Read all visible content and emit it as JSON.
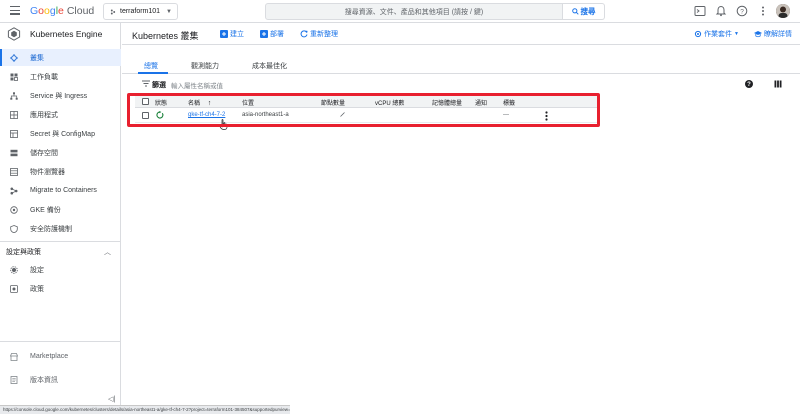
{
  "topbar": {
    "logo_google": [
      "G",
      "o",
      "o",
      "g",
      "l",
      "e"
    ],
    "logo_cloud": "Cloud",
    "project": "terraform101",
    "search_placeholder": "搜尋資源、文件、產品和其他項目 (請按 / 鍵)",
    "search_button": "搜尋"
  },
  "sidebar": {
    "product_title": "Kubernetes Engine",
    "items": [
      {
        "label": "叢集",
        "icon": "clusters-icon"
      },
      {
        "label": "工作負載",
        "icon": "workloads-icon"
      },
      {
        "label": "Service 與 Ingress",
        "icon": "services-icon"
      },
      {
        "label": "應用程式",
        "icon": "applications-icon"
      },
      {
        "label": "Secret 與 ConfigMap",
        "icon": "secrets-icon"
      },
      {
        "label": "儲存空間",
        "icon": "storage-icon"
      },
      {
        "label": "物件瀏覽器",
        "icon": "object-browser-icon"
      },
      {
        "label": "Migrate to Containers",
        "icon": "migrate-icon"
      },
      {
        "label": "GKE 備份",
        "icon": "backup-icon"
      },
      {
        "label": "安全防護機制",
        "icon": "security-icon"
      }
    ],
    "section_title": "設定與政策",
    "section_items": [
      {
        "label": "設定",
        "icon": "settings-icon"
      },
      {
        "label": "政策",
        "icon": "policy-icon"
      }
    ],
    "bottom_items": [
      {
        "label": "Marketplace",
        "icon": "marketplace-icon"
      },
      {
        "label": "版本資訊",
        "icon": "release-notes-icon"
      }
    ]
  },
  "main": {
    "title": "Kubernetes 叢集",
    "actions": {
      "create": "建立",
      "deploy": "部署",
      "refresh": "重新整理",
      "operations": "作業套件",
      "learn": "瞭解詳情"
    },
    "tabs": [
      "總覽",
      "觀測能力",
      "成本最佳化"
    ],
    "filter": {
      "label": "篩選",
      "placeholder": "輸入屬性名稱或值"
    },
    "table": {
      "headers": {
        "status": "狀態",
        "name": "名稱",
        "location": "位置",
        "nodes": "節點數量",
        "vcpu": "vCPU 總數",
        "memory": "記憶體總量",
        "notifications": "通知",
        "labels": "標籤"
      },
      "rows": [
        {
          "name": "gke-tf-ch4-7-2",
          "location": "asia-northeast1-a",
          "nodes": "",
          "labels": "—"
        }
      ]
    }
  },
  "statusbar_url": "https://console.cloud.google.com/kubernetes/clusters/details/asia-northeast1-a/gke-tf-ch4-7-2?project=terraform101-384507&supportedpurview=project",
  "colors": {
    "accent": "#1a73e8",
    "highlight": "#e8202f",
    "status_ok": "#188038"
  }
}
